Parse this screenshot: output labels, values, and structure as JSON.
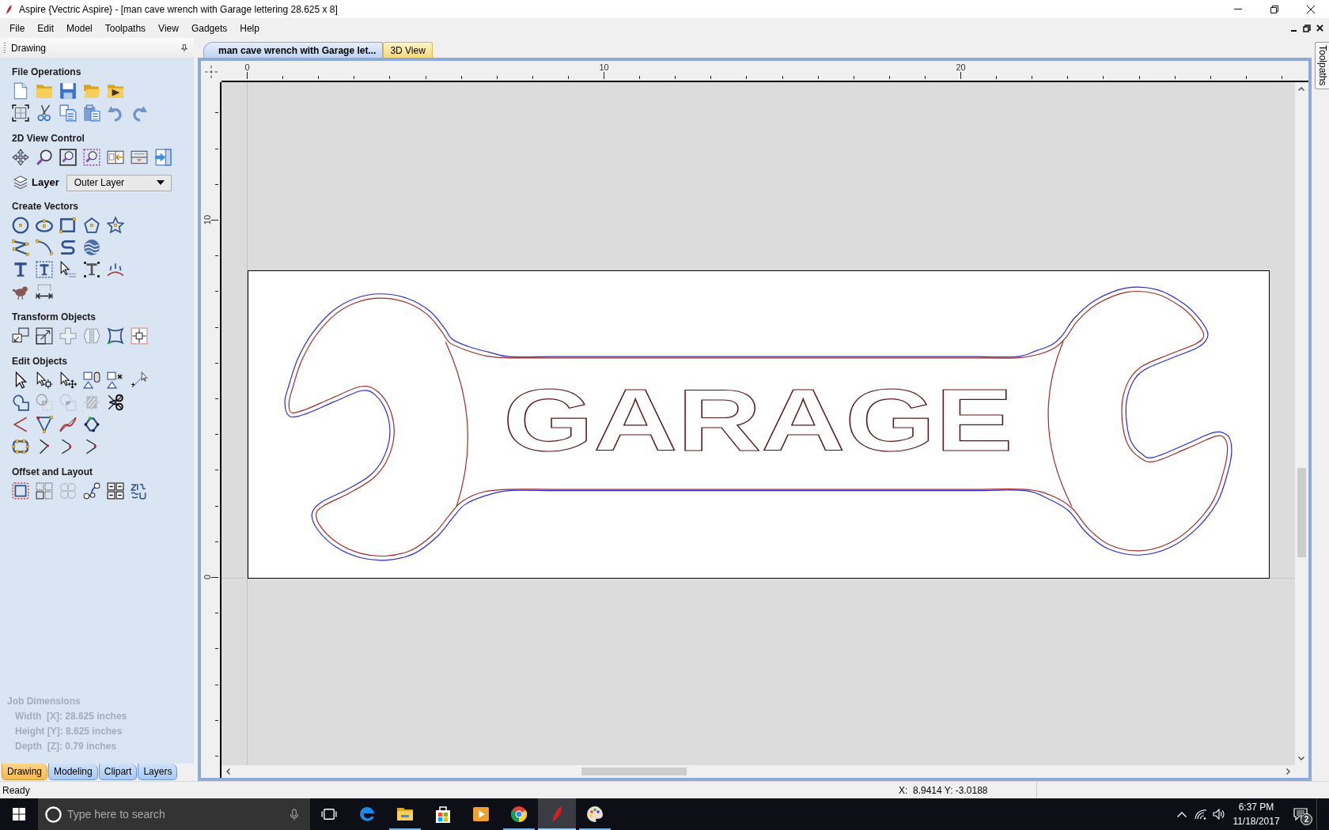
{
  "window": {
    "title": "Aspire {Vectric Aspire} - [man cave wrench with Garage lettering 28.625 x 8]"
  },
  "menu": [
    "File",
    "Edit",
    "Model",
    "Toolpaths",
    "View",
    "Gadgets",
    "Help"
  ],
  "drawing_panel": {
    "title": "Drawing",
    "sections": [
      {
        "kind": "tools",
        "title": "File Operations",
        "rows": [
          [
            {
              "disabled": false
            },
            {
              "disabled": false
            },
            {
              "disabled": false
            },
            {
              "disabled": false
            },
            {
              "disabled": false
            }
          ],
          [
            {
              "disabled": false
            },
            {
              "disabled": false
            },
            {
              "disabled": false
            },
            {
              "disabled": false
            },
            {
              "disabled": false
            },
            {
              "disabled": false
            }
          ]
        ]
      },
      {
        "kind": "tools",
        "title": "2D View Control",
        "rows": [
          [
            {
              "disabled": false
            },
            {
              "disabled": false
            },
            {
              "disabled": false
            },
            {
              "disabled": false
            },
            {
              "disabled": false
            },
            {
              "disabled": false
            },
            {
              "disabled": false
            }
          ]
        ]
      },
      {
        "kind": "layer",
        "label": "Layer",
        "value": "Outer Layer"
      },
      {
        "kind": "tools",
        "title": "Create Vectors",
        "rows": [
          [
            {
              "disabled": false
            },
            {
              "disabled": false
            },
            {
              "disabled": false
            },
            {
              "disabled": false
            },
            {
              "disabled": false
            }
          ],
          [
            {
              "disabled": false
            },
            {
              "disabled": false
            },
            {
              "disabled": false
            },
            {
              "disabled": false
            }
          ],
          [
            {
              "disabled": false
            },
            {
              "disabled": false
            },
            {
              "disabled": false
            },
            {
              "disabled": false
            },
            {
              "disabled": false
            }
          ],
          [
            {
              "disabled": false
            },
            {
              "disabled": false
            }
          ]
        ]
      },
      {
        "kind": "tools",
        "title": "Transform Objects",
        "rows": [
          [
            {
              "disabled": false
            },
            {
              "disabled": false
            },
            {
              "disabled": true
            },
            {
              "disabled": true
            },
            {
              "disabled": false
            },
            {
              "disabled": false
            }
          ]
        ]
      },
      {
        "kind": "tools",
        "title": "Edit Objects",
        "rows": [
          [
            {
              "disabled": false
            },
            {
              "disabled": false
            },
            {
              "disabled": false
            },
            {
              "disabled": false
            },
            {
              "disabled": false
            },
            {
              "disabled": false
            }
          ],
          [
            {
              "disabled": false
            },
            {
              "disabled": true
            },
            {
              "disabled": true
            },
            {
              "disabled": true
            },
            {
              "disabled": false
            }
          ],
          [
            {
              "disabled": false
            },
            {
              "disabled": false
            },
            {
              "disabled": false
            },
            {
              "disabled": false
            }
          ],
          [
            {
              "disabled": false
            },
            {
              "disabled": false
            },
            {
              "disabled": false
            },
            {
              "disabled": false
            }
          ]
        ]
      },
      {
        "kind": "tools",
        "title": "Offset and Layout",
        "rows": [
          [
            {
              "disabled": false
            },
            {
              "disabled": false
            },
            {
              "disabled": true
            },
            {
              "disabled": false
            },
            {
              "disabled": false
            },
            {
              "disabled": false
            }
          ]
        ]
      }
    ],
    "job_dimensions": {
      "title": "Job Dimensions",
      "lines": [
        "Width  [X]: 28.625 inches",
        "Height [Y]: 8.625 inches",
        "Depth  [Z]: 0.79 inches"
      ]
    },
    "tabs": [
      {
        "label": "Drawing",
        "selected": true
      },
      {
        "label": "Modeling",
        "selected": false
      },
      {
        "label": "Clipart",
        "selected": false
      },
      {
        "label": "Layers",
        "selected": false
      }
    ]
  },
  "document_tabs": [
    {
      "label": "man cave wrench with Garage let...",
      "selected": true
    },
    {
      "label": "3D View",
      "selected": false
    }
  ],
  "rulers": {
    "top_labels": [
      "0",
      "10",
      "20"
    ],
    "left_labels": [
      "10",
      "0"
    ]
  },
  "design": {
    "lettering": "GARAGE"
  },
  "side_tab": {
    "label": "Toolpaths"
  },
  "status_bar": {
    "message": "Ready",
    "coordinates": "X:  8.9414 Y: -3.0188"
  },
  "taskbar": {
    "search_placeholder": "Type here to search",
    "apps": [
      {
        "open": false,
        "active": false
      },
      {
        "open": true,
        "active": false
      },
      {
        "open": false,
        "active": false
      },
      {
        "open": false,
        "active": false
      },
      {
        "open": true,
        "active": false
      },
      {
        "open": true,
        "active": true
      },
      {
        "open": true,
        "active": false
      }
    ],
    "time": "6:37 PM",
    "date": "11/18/2017",
    "notification_count": "2"
  }
}
